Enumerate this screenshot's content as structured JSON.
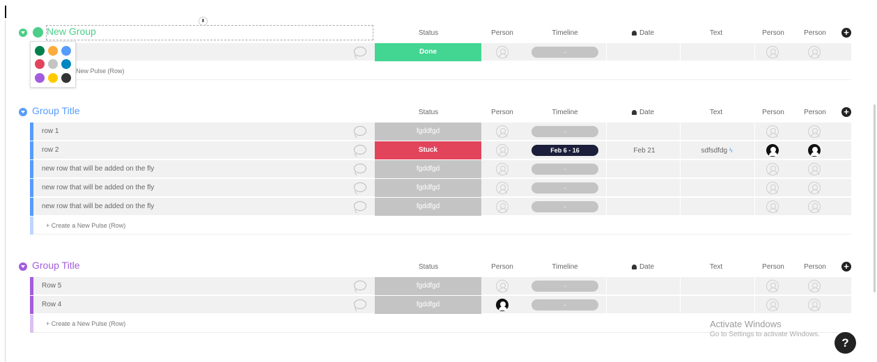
{
  "columns": {
    "status": "Status",
    "person": "Person",
    "timeline": "Timeline",
    "date": "Date",
    "text": "Text",
    "person2": "Person",
    "person3": "Person"
  },
  "colors": {
    "green": "#4cce88",
    "blue": "#579bfc",
    "purple": "#a25ddc",
    "done": "#42d692",
    "stuck": "#e2445c",
    "blank_status": "#c4c4c4"
  },
  "picker_swatches": [
    "#037f4c",
    "#fdab3d",
    "#579bfc",
    "#e2445c",
    "#c4c4c4",
    "#0086c0",
    "#a25ddc",
    "#ffcb00",
    "#333333"
  ],
  "create_label": "+ Create a New Pulse (Row)",
  "create_label_partial": "New Pulse (Row)",
  "groups": [
    {
      "title": "New Group",
      "rows": [
        {
          "name": "",
          "status": "Done",
          "timeline": "-",
          "date": "",
          "text": ""
        }
      ]
    },
    {
      "title": "Group Title",
      "rows": [
        {
          "name": "row 1",
          "status": "fgddfgd",
          "timeline": "-",
          "date": "",
          "text": ""
        },
        {
          "name": "row 2",
          "status": "Stuck",
          "timeline": "Feb 6 - 16",
          "date": "Feb 21",
          "text": "sdfsdfdg"
        },
        {
          "name": "new row that will be added on the fly",
          "status": "fgddfgd",
          "timeline": "-",
          "date": "",
          "text": ""
        },
        {
          "name": "new row that will be added on the fly",
          "status": "fgddfgd",
          "timeline": "-",
          "date": "",
          "text": ""
        },
        {
          "name": "new row that will be added on the fly",
          "status": "fgddfgd",
          "timeline": "-",
          "date": "",
          "text": ""
        }
      ]
    },
    {
      "title": "Group Title",
      "rows": [
        {
          "name": "Row 5",
          "status": "fgddfgd",
          "timeline": "-",
          "date": "",
          "text": ""
        },
        {
          "name": "Row 4",
          "status": "fgddfgd",
          "timeline": "-",
          "date": "",
          "text": ""
        }
      ]
    }
  ],
  "watermark": {
    "title": "Activate Windows",
    "subtitle": "Go to Settings to activate Windows."
  },
  "help_label": "?",
  "add_column_label": "+",
  "resize_glyph": "⬍"
}
